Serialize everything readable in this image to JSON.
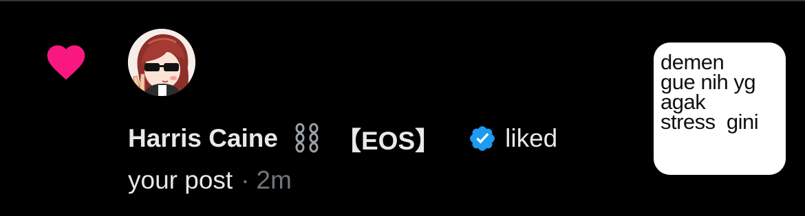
{
  "notification": {
    "type_icon": "heart-icon",
    "type_color": "#f91880",
    "avatar": "anime-avatar",
    "user": {
      "display_name": "Harris Caine",
      "emoji": "chain-icon",
      "tag": "【EOS】",
      "verified_icon": "verified-badge-icon",
      "verified_color": "#1d9bf0"
    },
    "action": "liked",
    "object": "your post",
    "separator": "·",
    "time": "2m",
    "post_preview": {
      "lines": [
        "demen",
        "gue nih yg",
        "agak",
        "stress  gini"
      ]
    }
  },
  "colors": {
    "background": "#000000",
    "primary_text": "#e7e9ea",
    "secondary_text": "#71767b"
  }
}
